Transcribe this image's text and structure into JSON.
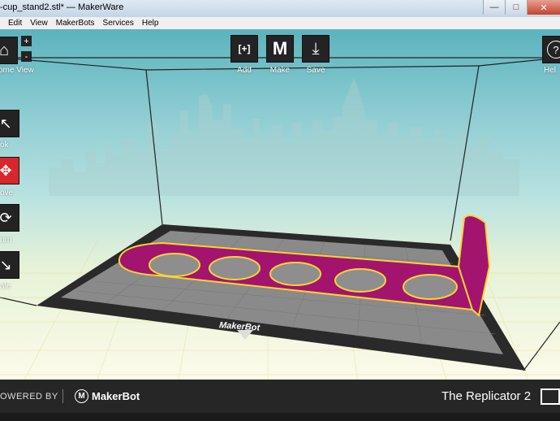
{
  "window": {
    "title": "-cup_stand2.stl* — MakerWare"
  },
  "menu": [
    "Edit",
    "View",
    "MakerBots",
    "Services",
    "Help"
  ],
  "view_controls": {
    "home_label": "ome View",
    "zoom_in": "+",
    "zoom_out": "-"
  },
  "toolbar": [
    {
      "label": "Add",
      "glyph": "[+]"
    },
    {
      "label": "Make",
      "glyph": "M"
    },
    {
      "label": "Save",
      "glyph": "⤓"
    }
  ],
  "help": {
    "label": "Hel",
    "glyph": "?"
  },
  "side_tools": [
    {
      "label": "ok",
      "icon": "look-icon"
    },
    {
      "label": "ove",
      "icon": "move-icon",
      "selected": true
    },
    {
      "label": "urn",
      "icon": "turn-icon"
    },
    {
      "label": "ale",
      "icon": "scale-icon"
    }
  ],
  "platform_brand": "MakerBot",
  "footer": {
    "powered_by": "OWERED BY",
    "logo_glyph": "M",
    "brand": "MakerBot",
    "printer_name": "The Replicator 2"
  },
  "colors": {
    "model": "#a3146f",
    "model_outline": "#f7d432",
    "selected_tool": "#d8262b",
    "toolbar_bg": "#232323"
  }
}
